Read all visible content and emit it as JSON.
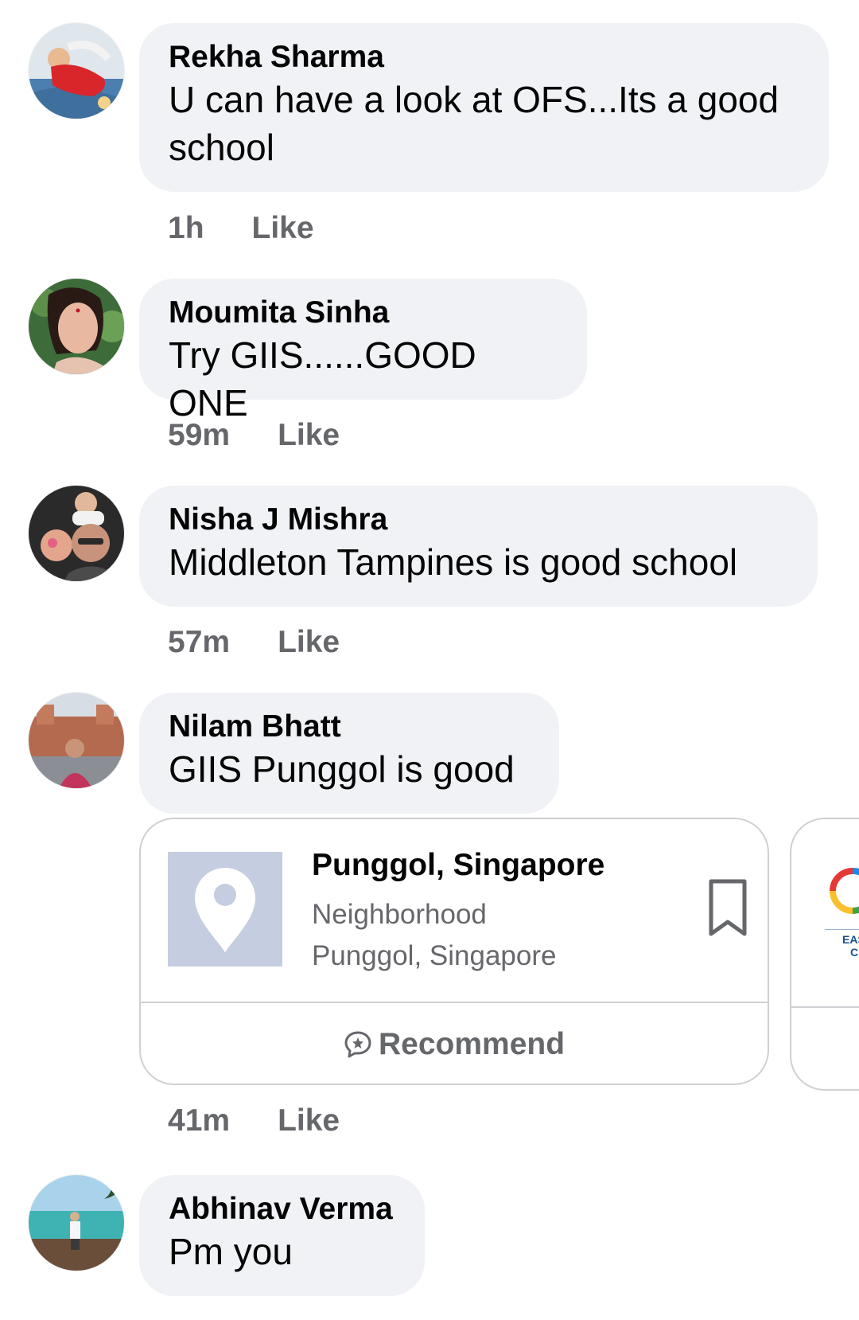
{
  "comments": [
    {
      "author": "Rekha Sharma",
      "text_line1": "U can have a look at OFS...Its a good",
      "text_line2": "school",
      "time": "1h",
      "like": "Like"
    },
    {
      "author": "Moumita Sinha",
      "text": "Try GIIS......GOOD ONE",
      "time": "59m",
      "like": "Like"
    },
    {
      "author": "Nisha J Mishra",
      "text": "Middleton Tampines is good school",
      "time": "57m",
      "like": "Like"
    },
    {
      "author": "Nilam Bhatt",
      "text": "GIIS Punggol is good",
      "time": "41m",
      "like": "Like"
    },
    {
      "author": "Abhinav Verma",
      "text": "Pm you"
    }
  ],
  "place_card": {
    "title": "Punggol, Singapore",
    "category": "Neighborhood",
    "location": "Punggol, Singapore",
    "recommend_label": "Recommend",
    "thumb_icon": "map-pin-icon",
    "save_icon": "bookmark-icon",
    "recommend_icon": "recommend-star-bubble-icon"
  },
  "peek_card": {
    "text_line1": "EAS",
    "text_line2": "C"
  },
  "colors": {
    "bubble_bg": "#f0f2f5",
    "meta_text": "#65676b",
    "card_border": "#ced0d4",
    "thumb_bg": "#c5cde0"
  }
}
